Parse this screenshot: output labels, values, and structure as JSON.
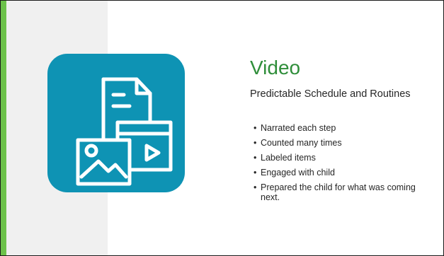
{
  "slide": {
    "title": "Video",
    "subtitle": "Predictable Schedule and Routines",
    "bullet_glyph": "•",
    "bullets": [
      "Narrated each step",
      "Counted many times",
      "Labeled  items",
      "Engaged with child",
      "Prepared the child for what was coming next."
    ]
  },
  "icon": {
    "name": "document-image-video-icon",
    "tile_color": "#0e93b4",
    "line_color": "#ffffff"
  },
  "colors": {
    "accent": "#6cc24a",
    "title": "#2f8e3a",
    "left_panel": "#f0f0f0",
    "text": "#262626"
  }
}
